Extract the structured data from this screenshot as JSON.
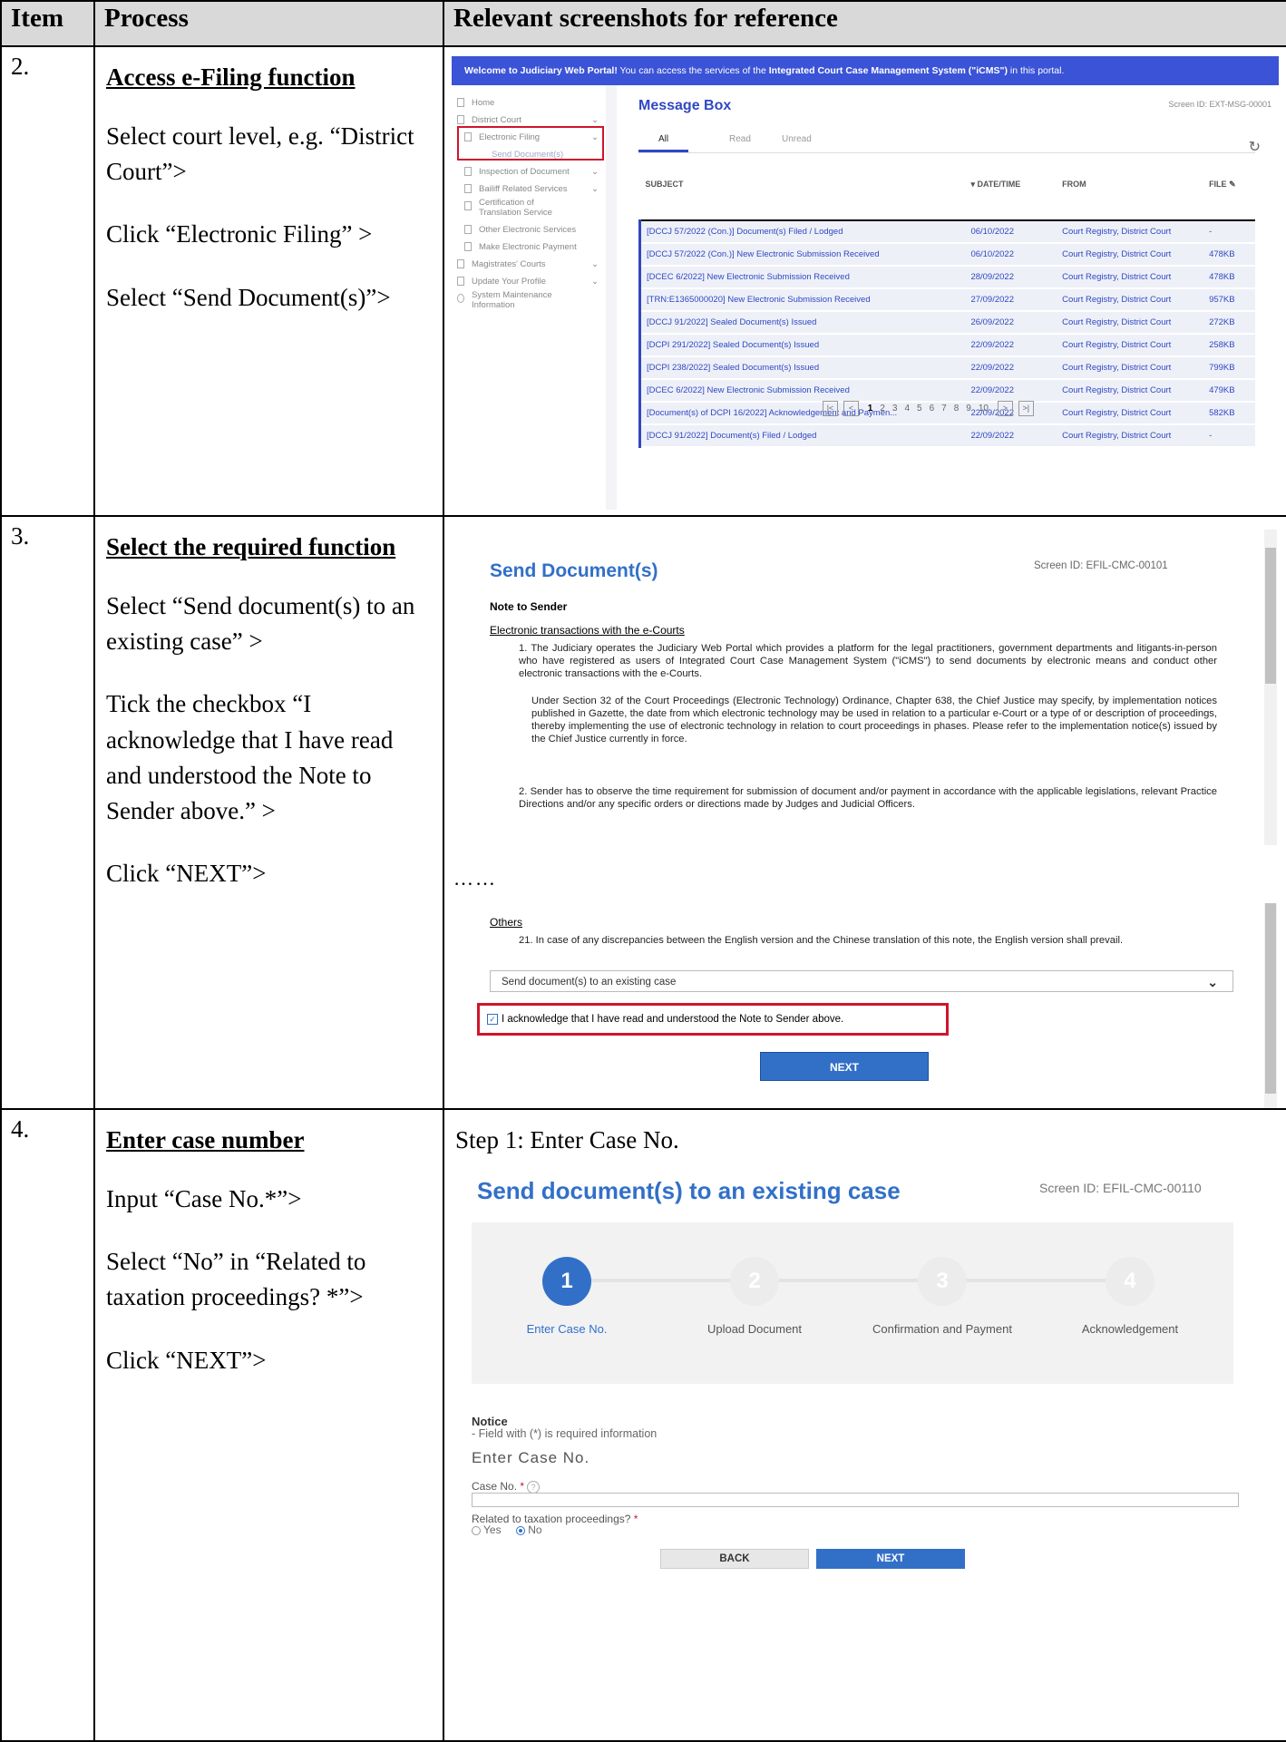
{
  "table": {
    "headers": {
      "item": "Item",
      "process": "Process",
      "screenshots": "Relevant screenshots for reference"
    },
    "rows": [
      {
        "item": "2.",
        "title": "Access e-Filing function",
        "steps": [
          "Select court level, e.g. “District Court”>",
          "Click “Electronic Filing” >",
          "Select “Send Document(s)”>"
        ]
      },
      {
        "item": "3.",
        "title": "Select the required function",
        "steps": [
          "Select “Send document(s) to an existing case” >",
          "Tick the checkbox “I acknowledge that I have read and understood the Note to Sender above.” >",
          "Click “NEXT”>"
        ]
      },
      {
        "item": "4.",
        "title": "Enter case number",
        "steps": [
          "Input “Case No.*”>",
          "Select “No” in “Related to taxation proceedings? *”>",
          "Click “NEXT”>"
        ]
      }
    ]
  },
  "shot1": {
    "banner_bold": "Welcome to Judiciary Web Portal!",
    "banner_text": " You can access the services of the ",
    "banner_bold2": "Integrated Court Case Management System (\"iCMS\")",
    "banner_tail": " in this portal.",
    "sidebar": [
      "Home",
      "District Court",
      "Electronic Filing",
      "Send Document(s)",
      "Inspection of Document",
      "Bailiff Related Services",
      "Certification of Translation Service",
      "Other Electronic Services",
      "Make Electronic Payment",
      "Magistrates' Courts",
      "Update Your Profile",
      "System Maintenance Information"
    ],
    "title": "Message Box",
    "screen_id": "Screen ID: EXT-MSG-00001",
    "tabs": [
      "All",
      "Read",
      "Unread"
    ],
    "columns": [
      "SUBJECT",
      "▾ DATE/TIME",
      "FROM",
      "FILE"
    ],
    "rows": [
      [
        "[DCCJ 57/2022 (Con.)] Document(s) Filed / Lodged",
        "06/10/2022",
        "Court Registry, District Court",
        "-"
      ],
      [
        "[DCCJ 57/2022 (Con.)] New Electronic Submission Received",
        "06/10/2022",
        "Court Registry, District Court",
        "478KB"
      ],
      [
        "[DCEC 6/2022] New Electronic Submission Received",
        "28/09/2022",
        "Court Registry, District Court",
        "478KB"
      ],
      [
        "[TRN:E1365000020] New Electronic Submission Received",
        "27/09/2022",
        "Court Registry, District Court",
        "957KB"
      ],
      [
        "[DCCJ 91/2022] Sealed Document(s) Issued",
        "26/09/2022",
        "Court Registry, District Court",
        "272KB"
      ],
      [
        "[DCPI 291/2022] Sealed Document(s) Issued",
        "22/09/2022",
        "Court Registry, District Court",
        "258KB"
      ],
      [
        "[DCPI 238/2022] Sealed Document(s) Issued",
        "22/09/2022",
        "Court Registry, District Court",
        "799KB"
      ],
      [
        "[DCEC 6/2022] New Electronic Submission Received",
        "22/09/2022",
        "Court Registry, District Court",
        "479KB"
      ],
      [
        "[Document(s) of DCPI 16/2022] Acknowledgement and Paymen...",
        "22/09/2022",
        "Court Registry, District Court",
        "582KB"
      ],
      [
        "[DCCJ 91/2022] Document(s) Filed / Lodged",
        "22/09/2022",
        "Court Registry, District Court",
        "-"
      ]
    ],
    "pages": [
      "1",
      "2",
      "3",
      "4",
      "5",
      "6",
      "7",
      "8",
      "9",
      "10"
    ]
  },
  "shot2": {
    "title": "Send Document(s)",
    "screen_id": "Screen ID: EFIL-CMC-00101",
    "note_heading": "Note to Sender",
    "section1": "Electronic transactions with the e-Courts",
    "p1": "1. The Judiciary operates the Judiciary Web Portal which provides a platform for the legal practitioners, government departments and litigants-in-person who have registered as users of Integrated Court Case Management System (\"iCMS\") to send documents by electronic means and conduct other electronic transactions with the e-Courts.",
    "p2": "Under Section 32 of the Court Proceedings (Electronic Technology) Ordinance, Chapter 638, the Chief Justice may specify, by implementation notices published in Gazette, the date from which electronic technology may be used in relation to a particular e-Court or a type of or description of proceedings, thereby implementing the use of electronic technology in relation to court proceedings in phases. Please refer to the implementation notice(s) issued by the Chief Justice currently in force.",
    "p3": "2. Sender has to observe the time requirement for submission of document and/or payment in accordance with the applicable legislations, relevant Practice Directions and/or any specific orders or directions made by Judges and Judicial Officers.",
    "ellipsis": "……",
    "section2": "Others",
    "p4": "21. In case of any discrepancies between the English version and the Chinese translation of this note, the English version shall prevail.",
    "select_value": "Send document(s) to an existing case",
    "ack": "I acknowledge that I have read and understood the Note to Sender above.",
    "next": "NEXT"
  },
  "shot3": {
    "step_label": "Step 1: Enter Case No.",
    "title": "Send document(s) to an existing case",
    "screen_id": "Screen ID: EFIL-CMC-00110",
    "steps": [
      {
        "num": "1",
        "label": "Enter Case No."
      },
      {
        "num": "2",
        "label": "Upload Document"
      },
      {
        "num": "3",
        "label": "Confirmation and Payment"
      },
      {
        "num": "4",
        "label": "Acknowledgement"
      }
    ],
    "notice": "Notice",
    "notice_sub": "- Field with (*) is required information",
    "section": "Enter Case No.",
    "case_label": "Case No.",
    "tax_label": "Related to taxation proceedings?",
    "yes": "Yes",
    "no": "No",
    "back": "BACK",
    "next": "NEXT"
  }
}
